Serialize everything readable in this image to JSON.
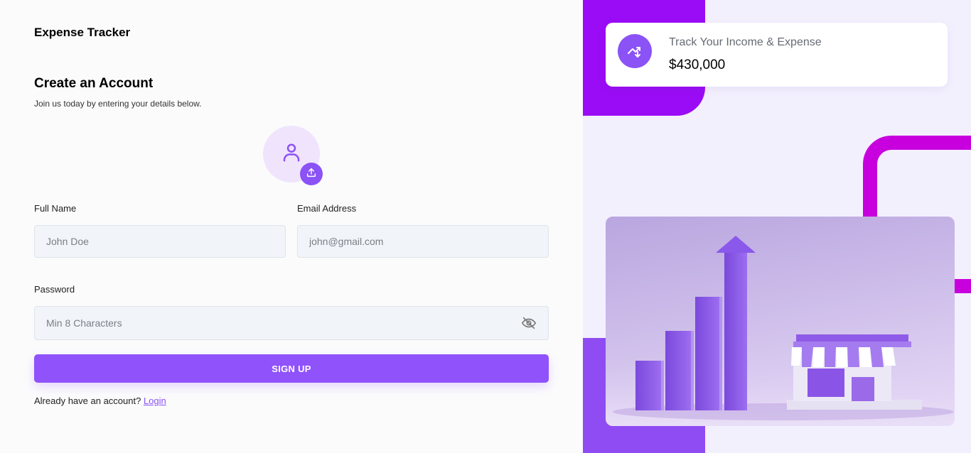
{
  "app": {
    "title": "Expense Tracker"
  },
  "form": {
    "heading": "Create an Account",
    "subheading": "Join us today by entering your details below.",
    "full_name": {
      "label": "Full Name",
      "placeholder": "John Doe",
      "value": ""
    },
    "email": {
      "label": "Email Address",
      "placeholder": "john@gmail.com",
      "value": ""
    },
    "password": {
      "label": "Password",
      "placeholder": "Min 8 Characters",
      "value": ""
    },
    "submit_label": "SIGN UP",
    "login_prompt": "Already have an account?",
    "login_link": "Login"
  },
  "stat_card": {
    "label": "Track Your Income & Expense",
    "value": "$430,000",
    "icon": "trending-up-icon"
  },
  "colors": {
    "accent": "#8f52fb",
    "block_top": "#9a0cf5",
    "block_bottom": "#8f4cf3",
    "outline": "#c800de",
    "input_bg": "#f1f4f9"
  }
}
